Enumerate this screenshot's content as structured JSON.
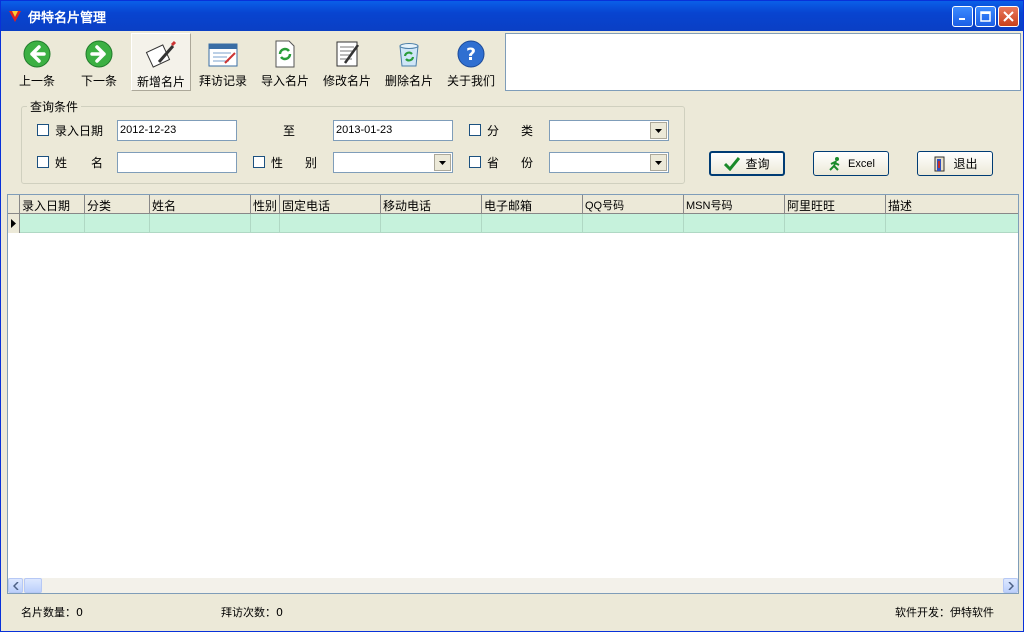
{
  "window": {
    "title": "伊特名片管理"
  },
  "toolbar": {
    "prev": "上一条",
    "next": "下一条",
    "new_card": "新增名片",
    "visit_log": "拜访记录",
    "import": "导入名片",
    "edit": "修改名片",
    "delete": "删除名片",
    "about": "关于我们"
  },
  "query": {
    "legend": "查询条件",
    "entry_date_label": "录入日期",
    "date_from": "2012-12-23",
    "to_label": "至",
    "date_to": "2013-01-23",
    "category_label_a": "分",
    "category_label_b": "类",
    "name_label_a": "姓",
    "name_label_b": "名",
    "name_value": "",
    "gender_label_a": "性",
    "gender_label_b": "别",
    "province_label_a": "省",
    "province_label_b": "份",
    "search_button": "查询",
    "excel_button": "Excel",
    "exit_button": "退出"
  },
  "grid": {
    "columns": [
      "录入日期",
      "分类",
      "姓名",
      "性别",
      "固定电话",
      "移动电话",
      "电子邮箱",
      "QQ号码",
      "MSN号码",
      "阿里旺旺",
      "描述"
    ]
  },
  "status": {
    "card_count": "名片数量：0",
    "visit_count": "拜访次数：0",
    "developer": "软件开发：伊特软件"
  },
  "colors": {
    "row_highlight": "#c6f2dc",
    "titlebar": "#0a4fd8"
  }
}
